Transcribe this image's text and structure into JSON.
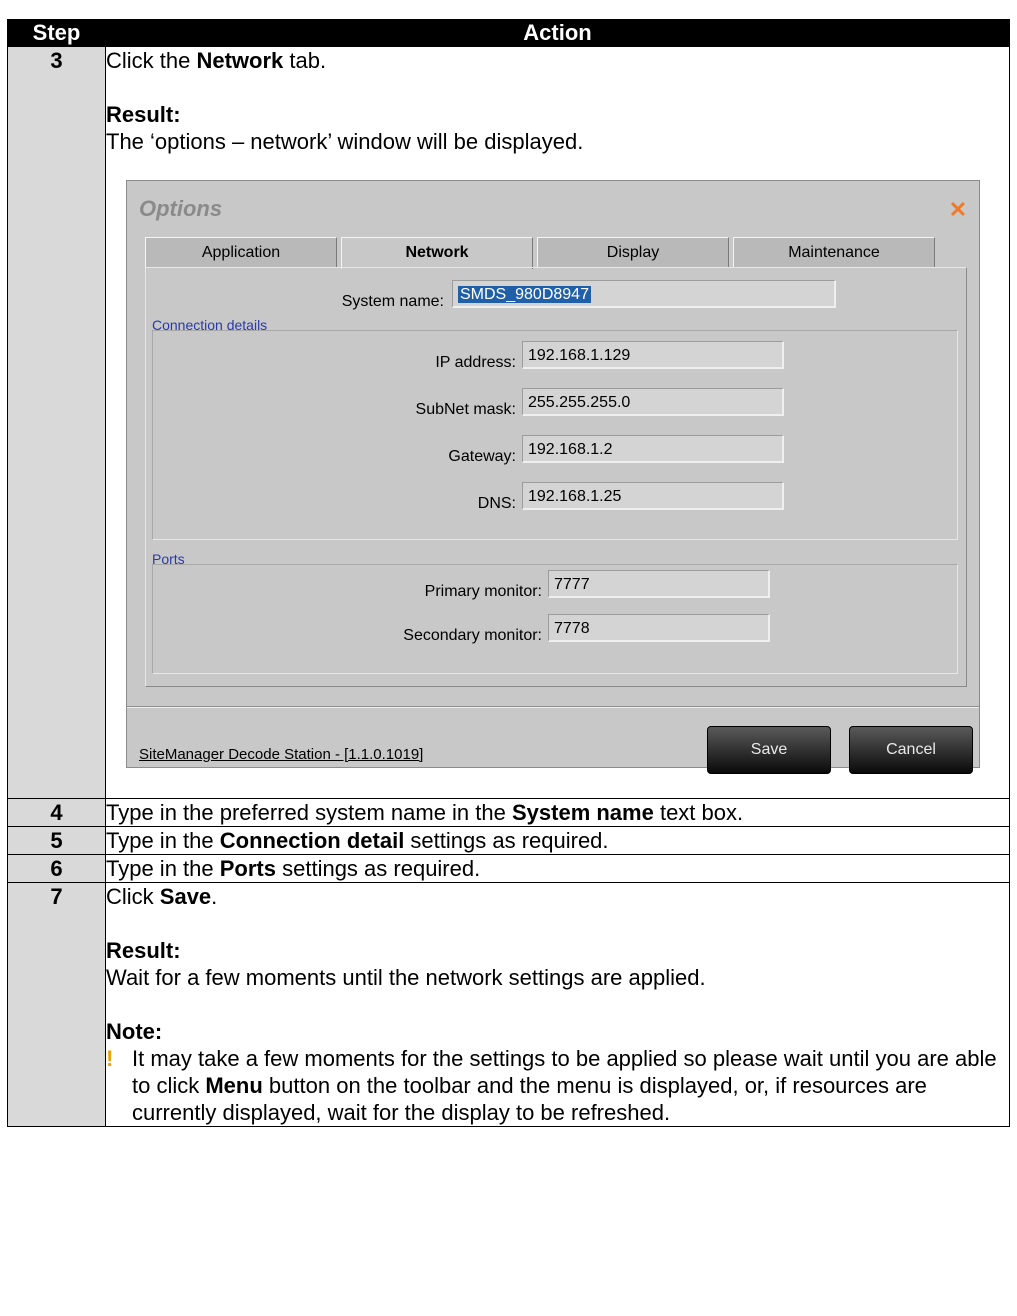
{
  "header": {
    "step": "Step",
    "action": "Action"
  },
  "rows": [
    {
      "step": "3",
      "line1_pre": "Click the ",
      "line1_bold": "Network",
      "line1_post": " tab.",
      "result_label": "Result:",
      "result_text": "The ‘options – network’ window will be displayed."
    },
    {
      "step": "4",
      "pre": "Type in the preferred system name in the ",
      "bold": "System name",
      "post": " text box."
    },
    {
      "step": "5",
      "pre": "Type in the ",
      "bold": "Connection detail",
      "post": " settings as required."
    },
    {
      "step": "6",
      "pre": "Type in the ",
      "bold": "Ports",
      "post": " settings as required."
    },
    {
      "step": "7",
      "line1_pre": "Click ",
      "line1_bold": "Save",
      "line1_post": ".",
      "result_label": "Result:",
      "result_text": "Wait for a few moments until the network settings are applied.",
      "note_label": "Note:",
      "note_bullet": "!",
      "note_pre": "It may take a few moments for the settings to be applied so please wait until you are able to click ",
      "note_bold": "Menu",
      "note_post": " button on the toolbar and the menu is displayed, or, if resources are currently displayed, wait for the display to be refreshed."
    }
  ],
  "dialog": {
    "title": "Options",
    "close_icon": "close-x-icon",
    "tabs": [
      "Application",
      "Network",
      "Display",
      "Maintenance"
    ],
    "active_tab": "Network",
    "system_name_label": "System name:",
    "system_name_value": "SMDS_980D8947",
    "connection_group": "Connection details",
    "ip_label": "IP address:",
    "ip_value": "192.168.1.129",
    "subnet_label": "SubNet mask:",
    "subnet_value": "255.255.255.0",
    "gateway_label": "Gateway:",
    "gateway_value": "192.168.1.2",
    "dns_label": "DNS:",
    "dns_value": "192.168.1.25",
    "ports_group": "Ports",
    "primary_label": "Primary monitor:",
    "primary_value": "7777",
    "secondary_label": "Secondary monitor:",
    "secondary_value": "7778",
    "footer": "SiteManager Decode Station - [1.1.0.1019]",
    "save": "Save",
    "cancel": "Cancel"
  },
  "colors": {
    "header_bg": "#000000",
    "step_bg": "#d9d9d9",
    "note_bullet": "#f0a000",
    "close_icon": "#f07a2a"
  }
}
